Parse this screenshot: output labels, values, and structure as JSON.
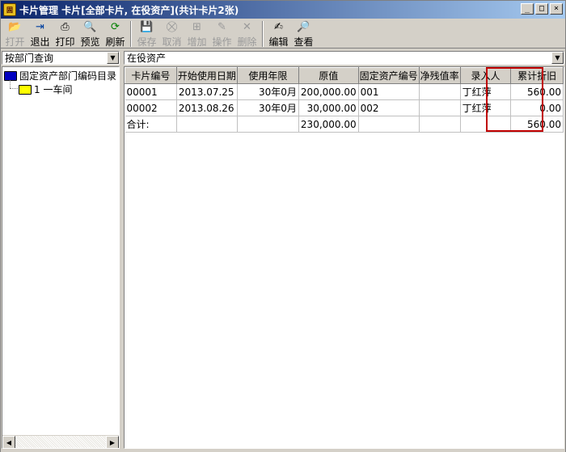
{
  "window": {
    "title": "卡片管理  卡片[全部卡片, 在役资产](共计卡片2张)",
    "icon_text": "固",
    "minimize": "_",
    "maximize": "□",
    "close": "×"
  },
  "toolbar": [
    {
      "label": "打开",
      "icon": "folder-open-icon",
      "glyph": "📂",
      "enabled": false
    },
    {
      "label": "退出",
      "icon": "exit-door-icon",
      "glyph": "⇥",
      "enabled": true
    },
    {
      "label": "打印",
      "icon": "printer-icon",
      "glyph": "⎙",
      "enabled": true
    },
    {
      "label": "预览",
      "icon": "preview-icon",
      "glyph": "🔍",
      "enabled": true
    },
    {
      "label": "刷新",
      "icon": "refresh-icon",
      "glyph": "⟳",
      "enabled": true
    },
    {
      "label": "保存",
      "icon": "save-icon",
      "glyph": "💾",
      "enabled": false
    },
    {
      "label": "取消",
      "icon": "cancel-icon",
      "glyph": "⛒",
      "enabled": false
    },
    {
      "label": "增加",
      "icon": "add-icon",
      "glyph": "⊞",
      "enabled": false
    },
    {
      "label": "操作",
      "icon": "operate-icon",
      "glyph": "✎",
      "enabled": false
    },
    {
      "label": "删除",
      "icon": "delete-icon",
      "glyph": "✕",
      "enabled": false
    },
    {
      "label": "编辑",
      "icon": "edit-icon",
      "glyph": "✍",
      "enabled": true
    },
    {
      "label": "查看",
      "icon": "view-icon",
      "glyph": "🔎",
      "enabled": true
    }
  ],
  "left": {
    "query_mode": "按部门查询",
    "tree_root": "固定资产部门编码目录",
    "tree_child": "1  一车间"
  },
  "right": {
    "filter": "在役资产"
  },
  "table": {
    "columns": [
      "卡片编号",
      "开始使用日期",
      "使用年限",
      "原值",
      "固定资产编号",
      "净残值率",
      "录入人",
      "累计折旧"
    ],
    "rows": [
      [
        "00001",
        "2013.07.25",
        "30年0月",
        "200,000.00",
        "001",
        "",
        "丁红萍",
        "560.00"
      ],
      [
        "00002",
        "2013.08.26",
        "30年0月",
        "30,000.00",
        "002",
        "",
        "丁红萍",
        "0.00"
      ],
      [
        "合计:",
        "",
        "",
        "230,000.00",
        "",
        "",
        "",
        "560.00"
      ]
    ]
  },
  "colors": {
    "title_start": "#0a246a",
    "title_end": "#a6caf0",
    "highlight": "#c00000",
    "folder": "#ffff00",
    "folder_root": "#0000c0"
  }
}
